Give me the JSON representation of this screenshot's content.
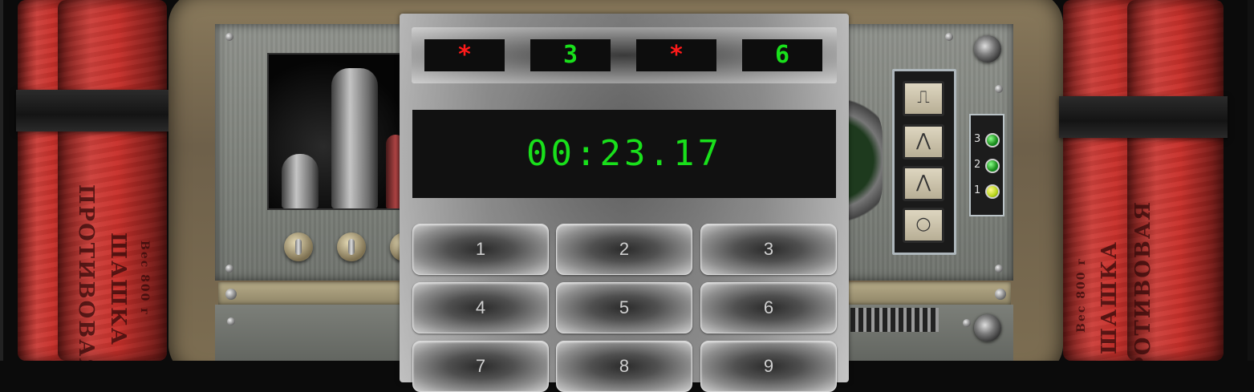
{
  "code_slots": [
    {
      "char": "*",
      "color": "#ff1a1a"
    },
    {
      "char": "3",
      "color": "#19e01b"
    },
    {
      "char": "*",
      "color": "#ff1a1a"
    },
    {
      "char": "6",
      "color": "#19e01b"
    }
  ],
  "timer": "00:23.17",
  "keypad": [
    "1",
    "2",
    "3",
    "4",
    "5",
    "6",
    "7",
    "8",
    "9"
  ],
  "background": {
    "led_labels": [
      "3",
      "2",
      "1"
    ],
    "stick_text_left": [
      "ПРОТИВОВАЯ",
      "ШАШКА",
      "Вес 800 г"
    ],
    "stick_text_right": [
      "ПРОТИВОВАЯ",
      "ШАШКА",
      "Вес 800 г"
    ]
  },
  "colors": {
    "timer_green": "#19e01b",
    "hidden_red": "#ff1a1a"
  }
}
